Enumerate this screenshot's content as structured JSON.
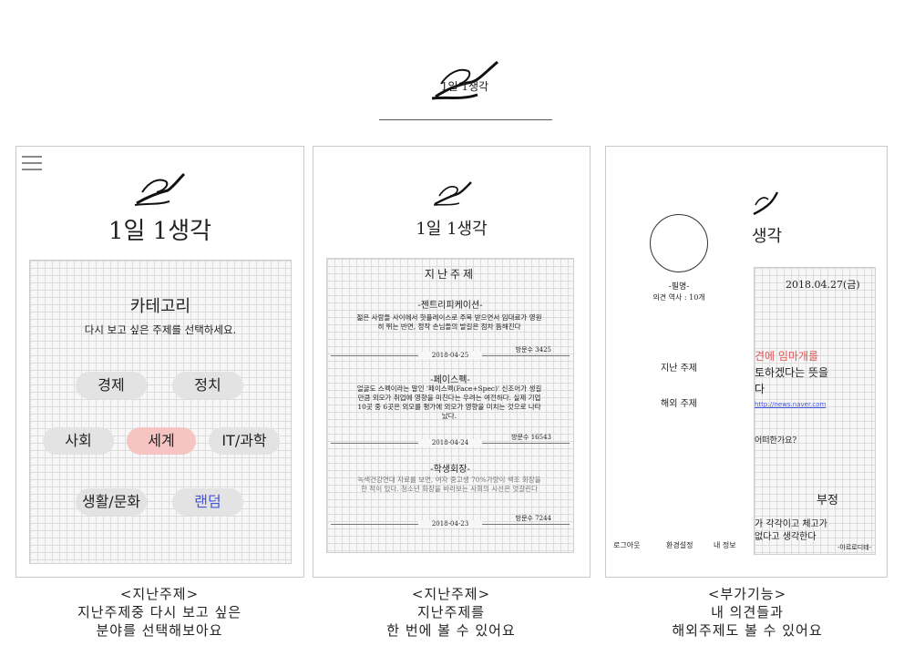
{
  "header": {
    "title": "1일 1생각"
  },
  "panel1": {
    "app_title": "1일 1생각",
    "category_heading": "카테고리",
    "category_subtitle": "다시 보고 싶은 주제를 선택하세요.",
    "categories": [
      "경제",
      "정치",
      "사회",
      "세계",
      "IT/과학",
      "생활/문화",
      "랜덤"
    ],
    "selected_category": "세계",
    "colors": {
      "selected": "#f7c4c4",
      "button": "#e3e3e3",
      "random_text": "#4455dd"
    }
  },
  "panel2": {
    "app_title": "1일 1생각",
    "list_heading": "지난주제",
    "posts": [
      {
        "title": "-젠트리피케이션-",
        "body": "젊은 사람들 사이에서 핫플레이스로 주목 받으면서 임대료가 영원히 뛰는 반면, 정작 손님들의 발길은 점차 뜸해진다",
        "views": "방문수 3425",
        "date": "2018-04-25"
      },
      {
        "title": "-페이스펙-",
        "body": "얼굴도 스펙이라는 말인 '페이스펙(Face+Spec)' 신조어가 생길 만큼 외모가 취업에 영향을 미친다는 우려는 여전하다. 실제 기업 10곳 중 6곳은 외모를 평가에 외모가 영향을 미치는 것으로 나타났다.",
        "views": "방문수 16543",
        "date": "2018-04-24"
      },
      {
        "title": "-학생회장-",
        "body": "녹색건강연대 자료를 보면, 여자 중고생 70%가량이 색조 화장을 한 적이 있다. 청소년 화장을 바라보는 사회의 시선은 엇갈린다",
        "views": "방문수 7244",
        "date": "2018-04-23"
      }
    ]
  },
  "panel3": {
    "partial_title": "생각",
    "nickname": "-필명-",
    "opinion_count_label": "의견 역사 : 10개",
    "menu_items": [
      "지난 주제",
      "해외 주제"
    ],
    "footer_items": [
      "로그아웃",
      "환경설정",
      "내 정보"
    ],
    "date": "2018.04.27(금)",
    "content_lines": [
      "견에 임마개를",
      "토하겠다는 뜻을",
      "다"
    ],
    "link_text": "http://news.naver.com",
    "question": "어떠한가요?",
    "negative_heading": "부정",
    "negative_lines": [
      "가 각각이고 체고가",
      "없다고 생각한다"
    ],
    "signature": "-아르로디테-",
    "highlight_color": "#e05555"
  },
  "captions": [
    {
      "title": "<지난주제>",
      "line1": "지난주제중 다시 보고 싶은",
      "line2": "분야를 선택해보아요"
    },
    {
      "title": "<지난주제>",
      "line1": "지난주제를",
      "line2": "한 번에 볼 수 있어요"
    },
    {
      "title": "<부가기능>",
      "line1": "내 의견들과",
      "line2": "해외주제도 볼 수 있어요"
    }
  ]
}
